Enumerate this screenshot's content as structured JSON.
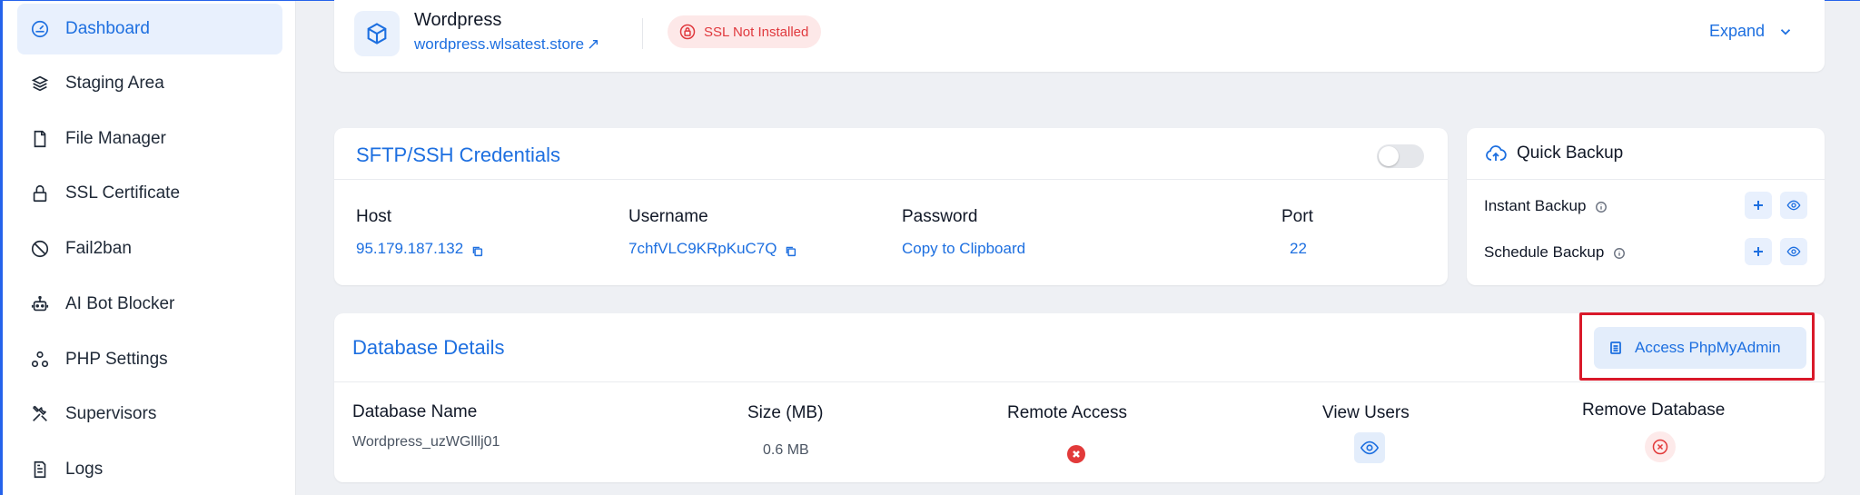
{
  "sidebar": {
    "items": [
      {
        "label": "Dashboard",
        "icon": "gauge-icon"
      },
      {
        "label": "Staging Area",
        "icon": "layers-icon"
      },
      {
        "label": "File Manager",
        "icon": "file-icon"
      },
      {
        "label": "SSL Certificate",
        "icon": "lock-icon"
      },
      {
        "label": "Fail2ban",
        "icon": "ban-icon"
      },
      {
        "label": "AI Bot Blocker",
        "icon": "robot-icon"
      },
      {
        "label": "PHP Settings",
        "icon": "nodes-icon"
      },
      {
        "label": "Supervisors",
        "icon": "tools-icon"
      },
      {
        "label": "Logs",
        "icon": "document-icon"
      }
    ],
    "active": "Dashboard"
  },
  "site": {
    "name": "Wordpress",
    "url": "wordpress.wlsatest.store",
    "url_arrow": "↗",
    "ssl_status": "SSL Not Installed",
    "expand_label": "Expand"
  },
  "sftp": {
    "title": "SFTP/SSH Credentials",
    "host_label": "Host",
    "host_value": "95.179.187.132",
    "username_label": "Username",
    "username_value": "7chfVLC9KRpKuC7Q",
    "password_label": "Password",
    "password_value": "Copy to Clipboard",
    "port_label": "Port",
    "port_value": "22"
  },
  "quick_backup": {
    "title": "Quick Backup",
    "instant_label": "Instant Backup",
    "schedule_label": "Schedule Backup"
  },
  "database": {
    "title": "Database Details",
    "access_button": "Access PhpMyAdmin",
    "headers": {
      "name": "Database Name",
      "size": "Size (MB)",
      "remote": "Remote Access",
      "users": "View Users",
      "remove": "Remove Database"
    },
    "row": {
      "name": "Wordpress_uzWGlllj01",
      "size": "0.6 MB"
    }
  },
  "colors": {
    "accent": "#1d6fe0",
    "danger": "#e23a3a",
    "highlight": "#d9192a"
  }
}
